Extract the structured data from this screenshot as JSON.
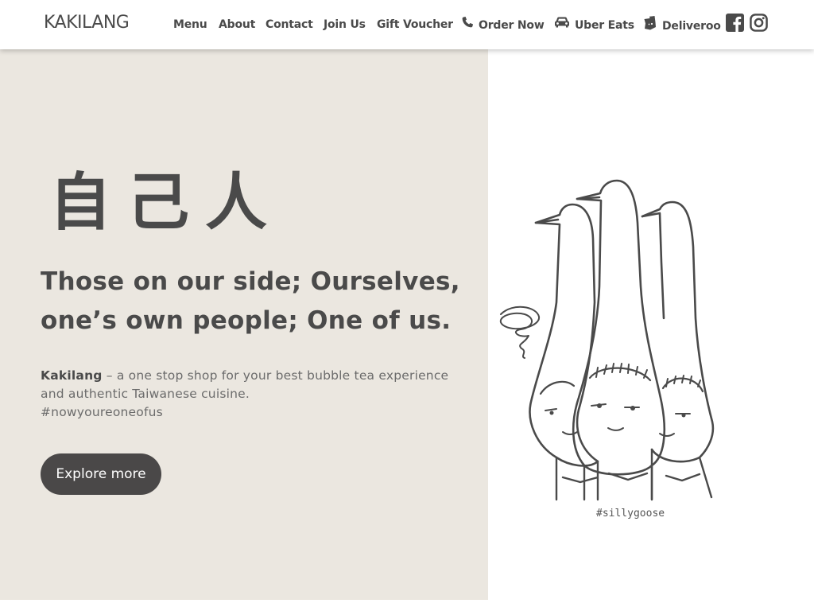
{
  "header": {
    "logo": "KAKILANG",
    "nav": {
      "menu": "Menu",
      "about": "About",
      "contact": "Contact",
      "join": "Join Us",
      "voucher": "Gift Voucher",
      "order": "Order Now",
      "uber": "Uber Eats",
      "deliveroo": "Deliveroo"
    },
    "icons": {
      "order": "phone-icon",
      "uber": "car-icon",
      "deliveroo": "deliveroo-icon",
      "facebook": "facebook-icon",
      "instagram": "instagram-icon"
    }
  },
  "hero": {
    "chinese": "自己人",
    "tagline_line1": "Those on our side; Ourselves,",
    "tagline_line2": "one’s own people; One of us.",
    "brand": "Kakilang",
    "description": " – a one stop shop for your best bubble tea experience and authentic Taiwanese cuisine.",
    "hashtag": "#nowyoureoneofus",
    "button": "Explore more"
  },
  "illustration": {
    "caption": "#sillygoose"
  },
  "colors": {
    "text": "#4a4a4a",
    "hero_bg": "#ebe7e0",
    "button_bg": "#4a4848",
    "button_text": "#ffffff"
  }
}
